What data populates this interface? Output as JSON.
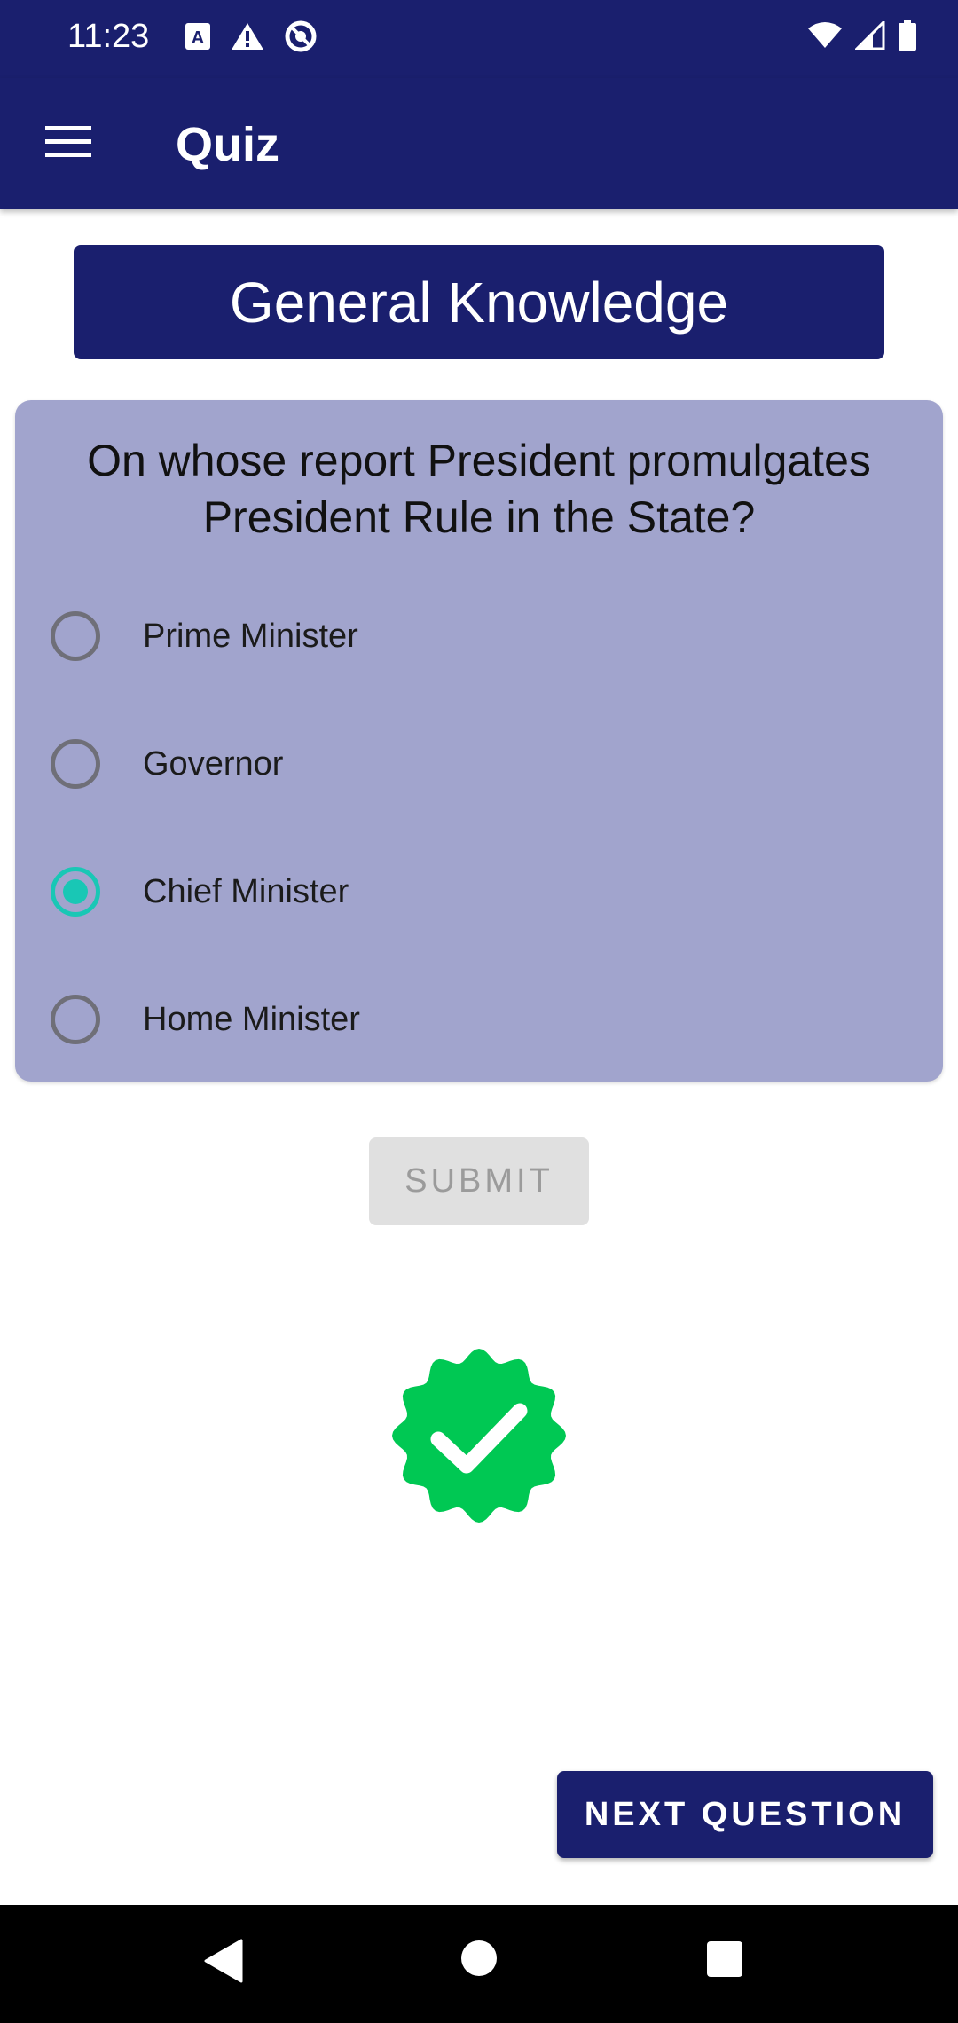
{
  "status_bar": {
    "time": "11:23",
    "left_icons": [
      "font-a-icon",
      "alert-triangle-icon",
      "do-not-disturb-icon"
    ],
    "right_icons": [
      "wifi-icon",
      "signal-icon",
      "battery-icon"
    ]
  },
  "app_bar": {
    "title": "Quiz",
    "menu_icon": "hamburger-menu-icon",
    "color": "#1a1f6e"
  },
  "category": {
    "label": "General Knowledge"
  },
  "question": {
    "text": "On whose report President promulgates President Rule in the State?",
    "options": [
      {
        "label": "Prime Minister",
        "selected": false
      },
      {
        "label": "Governor",
        "selected": false
      },
      {
        "label": "Chief Minister",
        "selected": true
      },
      {
        "label": "Home Minister",
        "selected": false
      }
    ],
    "card_color": "#a1a4cd",
    "selected_color": "#19c7b5"
  },
  "actions": {
    "submit_label": "SUBMIT",
    "next_label": "NEXT QUESTION"
  },
  "result": {
    "icon": "verified-check-badge-icon",
    "color": "#00c853"
  },
  "nav_bar": {
    "icons": [
      "back-triangle-icon",
      "home-circle-icon",
      "recents-square-icon"
    ]
  }
}
